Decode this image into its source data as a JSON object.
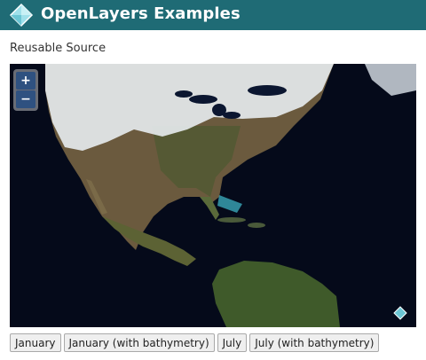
{
  "header": {
    "title": "OpenLayers Examples"
  },
  "page_title": "Reusable Source",
  "map": {
    "zoom_in_label": "+",
    "zoom_out_label": "−",
    "colors": {
      "ocean": "#050a1a",
      "land": "#6b5a3e",
      "vegetation": "#3f5a2a",
      "snow": "#e8ecf0",
      "shallow_water": "#3aa6b8",
      "brand_teal": "#1f6b75"
    }
  },
  "source_buttons": [
    {
      "label": "January"
    },
    {
      "label": "January (with bathymetry)"
    },
    {
      "label": "July"
    },
    {
      "label": "July (with bathymetry)"
    }
  ]
}
